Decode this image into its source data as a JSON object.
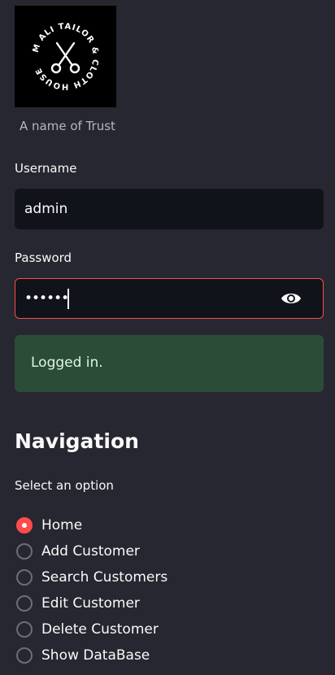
{
  "logo": {
    "text": "M ALI TAILOR & CLOTH HOUSE",
    "icon": "scissors-icon"
  },
  "caption": "A name of Trust",
  "username": {
    "label": "Username",
    "value": "admin"
  },
  "password": {
    "label": "Password",
    "masked_value": "••••••",
    "toggle_icon": "eye-icon"
  },
  "alert": {
    "message": "Logged in."
  },
  "navigation": {
    "title": "Navigation",
    "select_label": "Select an option",
    "options": [
      {
        "label": "Home",
        "checked": true
      },
      {
        "label": "Add Customer",
        "checked": false
      },
      {
        "label": "Search Customers",
        "checked": false
      },
      {
        "label": "Edit Customer",
        "checked": false
      },
      {
        "label": "Delete Customer",
        "checked": false
      },
      {
        "label": "Show DataBase",
        "checked": false
      }
    ]
  },
  "colors": {
    "background": "#262730",
    "input_bg": "#11131a",
    "accent": "#ff4b4b",
    "success_bg": "#2b4d38"
  }
}
